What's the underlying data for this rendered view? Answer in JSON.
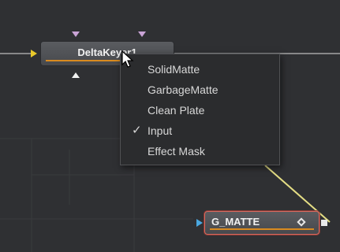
{
  "nodes": {
    "delta_keyer": {
      "label": "DeltaKeyer1"
    },
    "g_matte": {
      "label": "G_MATTE"
    }
  },
  "context_menu": {
    "items": [
      {
        "label": "SolidMatte",
        "checked": false
      },
      {
        "label": "GarbageMatte",
        "checked": false
      },
      {
        "label": "Clean Plate",
        "checked": false
      },
      {
        "label": "Input",
        "checked": true
      },
      {
        "label": "Effect Mask",
        "checked": false
      }
    ],
    "check_glyph": "✓"
  },
  "colors": {
    "background": "#2f3033",
    "node": "#505256",
    "accent_orange": "#d98b1f",
    "input_yellow": "#e9c92a",
    "mask_purple": "#c9a3d6",
    "input_blue": "#4aa7e0",
    "selection_red": "#d66a5f"
  },
  "icons": {
    "cursor": "arrow-cursor-icon",
    "keyframe": "diamond-icon"
  }
}
